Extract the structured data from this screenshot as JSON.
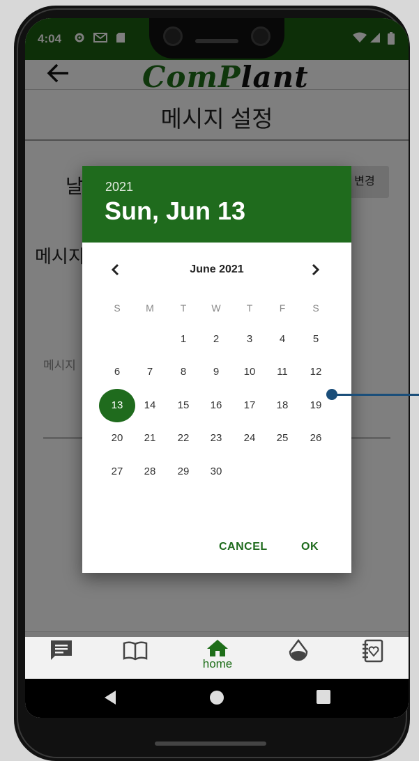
{
  "status_bar": {
    "time": "4:04"
  },
  "app": {
    "logo_part1": "Com",
    "logo_part2": "P",
    "logo_part3": "lant",
    "page_title": "메시지 설정",
    "date_label_partial": "날",
    "change_button_label_partial": "변경",
    "message_label_partial": "메시지",
    "message_hint_partial": "메시지"
  },
  "date_picker": {
    "year": "2021",
    "selected_date": "Sun, Jun 13",
    "month_label": "June 2021",
    "weekdays": [
      "S",
      "M",
      "T",
      "W",
      "T",
      "F",
      "S"
    ],
    "first_weekday_index": 2,
    "days_in_month": 30,
    "selected_day": 13,
    "cancel_label": "CANCEL",
    "ok_label": "OK",
    "accent_color": "#1f6b1d"
  },
  "bottom_nav": {
    "items": [
      {
        "icon": "chat-icon"
      },
      {
        "icon": "book-icon"
      },
      {
        "icon": "home-icon",
        "label": "home",
        "active": true
      },
      {
        "icon": "water-drop-icon"
      },
      {
        "icon": "journal-heart-icon"
      }
    ]
  },
  "colors": {
    "status_bar": "#1b5e10",
    "brand_green": "#1e6e19"
  }
}
